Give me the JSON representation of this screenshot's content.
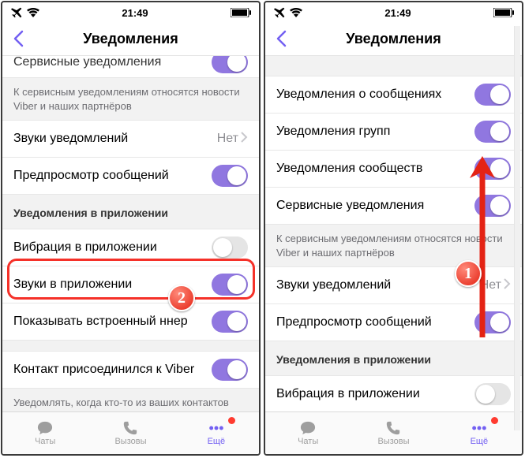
{
  "status": {
    "time": "21:49"
  },
  "nav": {
    "title": "Уведомления"
  },
  "colors": {
    "accent": "#7360f2",
    "toggle": "#9077e0",
    "danger": "#f53129"
  },
  "left": {
    "cutoff_label": "Сервисные уведомления",
    "footer1": "К сервисным уведомлениям относятся новости Viber и наших партнёров",
    "sounds_label": "Звуки уведомлений",
    "sounds_value": "Нет",
    "preview_label": "Предпросмотр сообщений",
    "section_inapp": "Уведомления в приложении",
    "vibration_label": "Вибрация в приложении",
    "inapp_sounds_label": "Звуки в приложении",
    "banner_label": "Показывать встроенный баннер",
    "banner_display": "Показывать встроенный   ннер",
    "joined_label": "Контакт присоединился к Viber",
    "footer2": "Уведомлять, когда кто-то из ваших контактов присоединяется к Viber"
  },
  "right": {
    "msg_label": "Уведомления о сообщениях",
    "group_label": "Уведомления групп",
    "community_label": "Уведомления сообществ",
    "service_label": "Сервисные уведомления",
    "footer1": "К сервисным уведомлениям относятся новости Viber и наших партнёров",
    "sounds_label": "Звуки уведомлений",
    "sounds_value": "Нет",
    "preview_label": "Предпросмотр сообщений",
    "section_inapp": "Уведомления в приложении",
    "vibration_label": "Вибрация в приложении"
  },
  "tabs": {
    "chats": "Чаты",
    "calls": "Вызовы",
    "more": "Ещё"
  },
  "annotations": {
    "step1": "1",
    "step2": "2"
  }
}
